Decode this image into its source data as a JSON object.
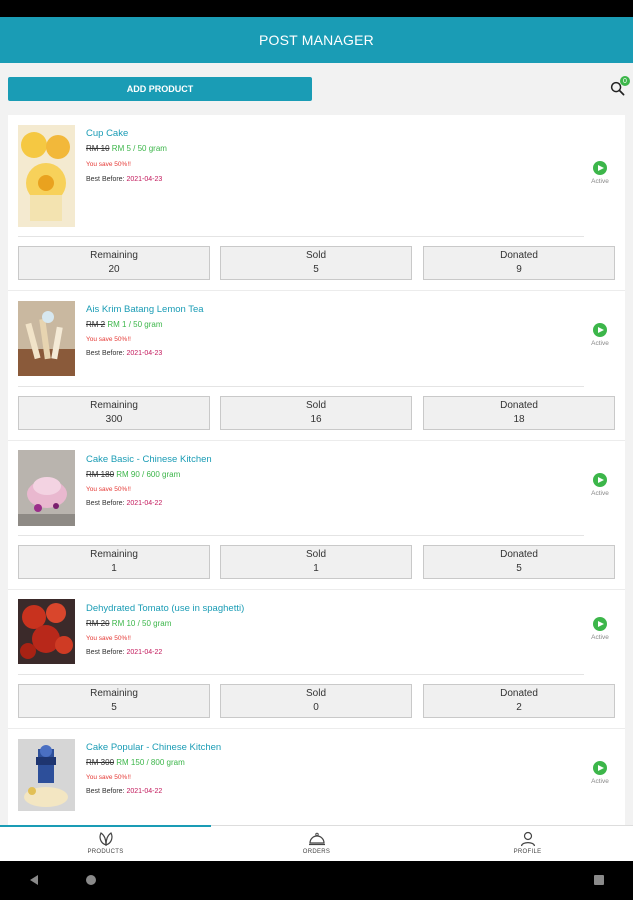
{
  "app": {
    "title": "POST MANAGER"
  },
  "toolbar": {
    "add_label": "ADD PRODUCT",
    "search_icon": "search-icon",
    "badge_count": "0"
  },
  "products": [
    {
      "name": "Cup Cake",
      "old_price": "RM 10",
      "new_price": "RM 5 / 50 gram",
      "save": "You save 50%!!",
      "best_label": "Best Before:",
      "best_date": "2021-04-23",
      "status": "Active",
      "remaining_label": "Remaining",
      "remaining": "20",
      "sold_label": "Sold",
      "sold": "5",
      "donated_label": "Donated",
      "donated": "9"
    },
    {
      "name": "Ais Krim Batang Lemon Tea",
      "old_price": "RM 2",
      "new_price": "RM 1 / 50 gram",
      "save": "You save 50%!!",
      "best_label": "Best Before:",
      "best_date": "2021-04-23",
      "status": "Active",
      "remaining_label": "Remaining",
      "remaining": "300",
      "sold_label": "Sold",
      "sold": "16",
      "donated_label": "Donated",
      "donated": "18"
    },
    {
      "name": "Cake Basic - Chinese Kitchen",
      "old_price": "RM 180",
      "new_price": "RM 90 / 600 gram",
      "save": "You save 50%!!",
      "best_label": "Best Before:",
      "best_date": "2021-04-22",
      "status": "Active",
      "remaining_label": "Remaining",
      "remaining": "1",
      "sold_label": "Sold",
      "sold": "1",
      "donated_label": "Donated",
      "donated": "5"
    },
    {
      "name": "Dehydrated Tomato (use in spaghetti)",
      "old_price": "RM 20",
      "new_price": "RM 10 / 50 gram",
      "save": "You save 50%!!",
      "best_label": "Best Before:",
      "best_date": "2021-04-22",
      "status": "Active",
      "remaining_label": "Remaining",
      "remaining": "5",
      "sold_label": "Sold",
      "sold": "0",
      "donated_label": "Donated",
      "donated": "2"
    },
    {
      "name": "Cake Popular - Chinese Kitchen",
      "old_price": "RM 300",
      "new_price": "RM 150 / 800 gram",
      "save": "You save 50%!!",
      "best_label": "Best Before:",
      "best_date": "2021-04-22",
      "status": "Active"
    }
  ],
  "nav": {
    "products": "PRODUCTS",
    "orders": "ORDERS",
    "profile": "PROFILE"
  },
  "colors": {
    "accent": "#1a9cb5",
    "active": "#3cb64a",
    "save": "#e53935",
    "date": "#c2185b"
  }
}
